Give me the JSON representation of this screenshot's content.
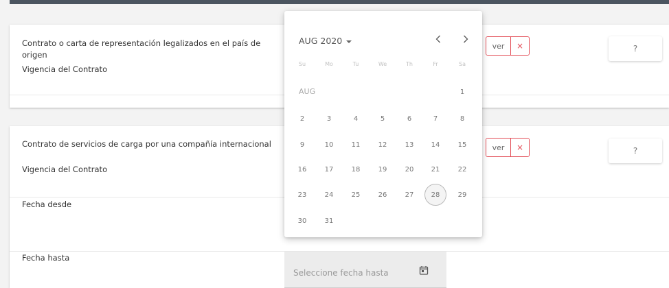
{
  "cards": [
    {
      "doc_label": "Contrato o carta de representación legalizados en el país de origen",
      "vigencia_label": "Vigencia del Contrato",
      "ver_label": "ver",
      "remove_label": "×",
      "help_label": "?"
    },
    {
      "doc_label": "Contrato de servicios de carga por una compañía internacional",
      "vigencia_label": "Vigencia del Contrato",
      "desde_label": "Fecha desde",
      "hasta_label": "Fecha hasta",
      "ver_label": "ver",
      "remove_label": "×",
      "help_label": "?"
    }
  ],
  "date_input": {
    "placeholder": "Seleccione fecha hasta",
    "icon": "calendar-icon"
  },
  "calendar": {
    "period_label": "AUG 2020",
    "month_label": "AUG",
    "weekdays": [
      "Su",
      "Mo",
      "Tu",
      "We",
      "Th",
      "Fr",
      "Sa"
    ],
    "first_weekday_index": 6,
    "days_in_month": 31,
    "selected_day": 28,
    "prev_icon": "chevron-left-icon",
    "next_icon": "chevron-right-icon"
  },
  "colors": {
    "accent_red": "#e24b55",
    "topbar": "#4b5560"
  }
}
